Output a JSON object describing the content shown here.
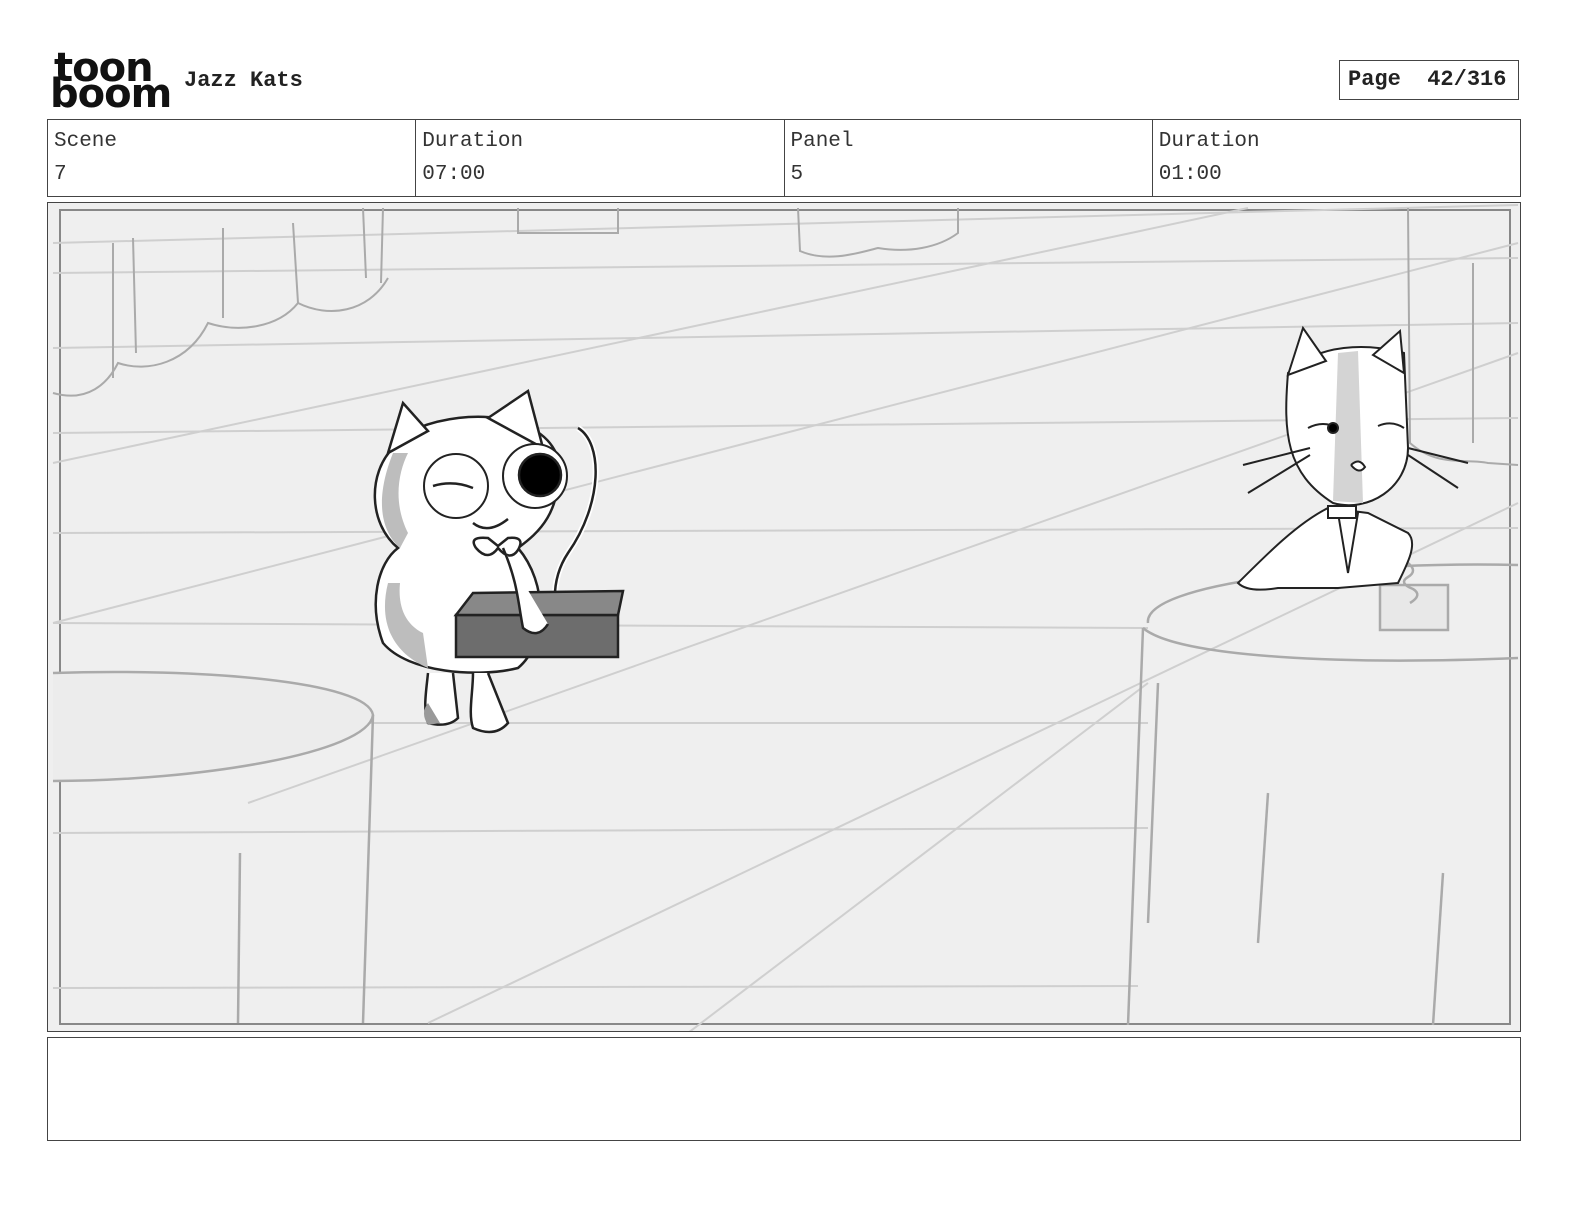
{
  "header": {
    "logo": {
      "line1": "toon",
      "line2": "boom"
    },
    "project_title": "Jazz Kats",
    "page_label": "Page",
    "page_number": "42/316"
  },
  "info": [
    {
      "label": "Scene",
      "value": "7"
    },
    {
      "label": "Duration",
      "value": "07:00"
    },
    {
      "label": "Panel",
      "value": "5"
    },
    {
      "label": "Duration",
      "value": "01:00"
    }
  ],
  "notes": {
    "text": ""
  }
}
